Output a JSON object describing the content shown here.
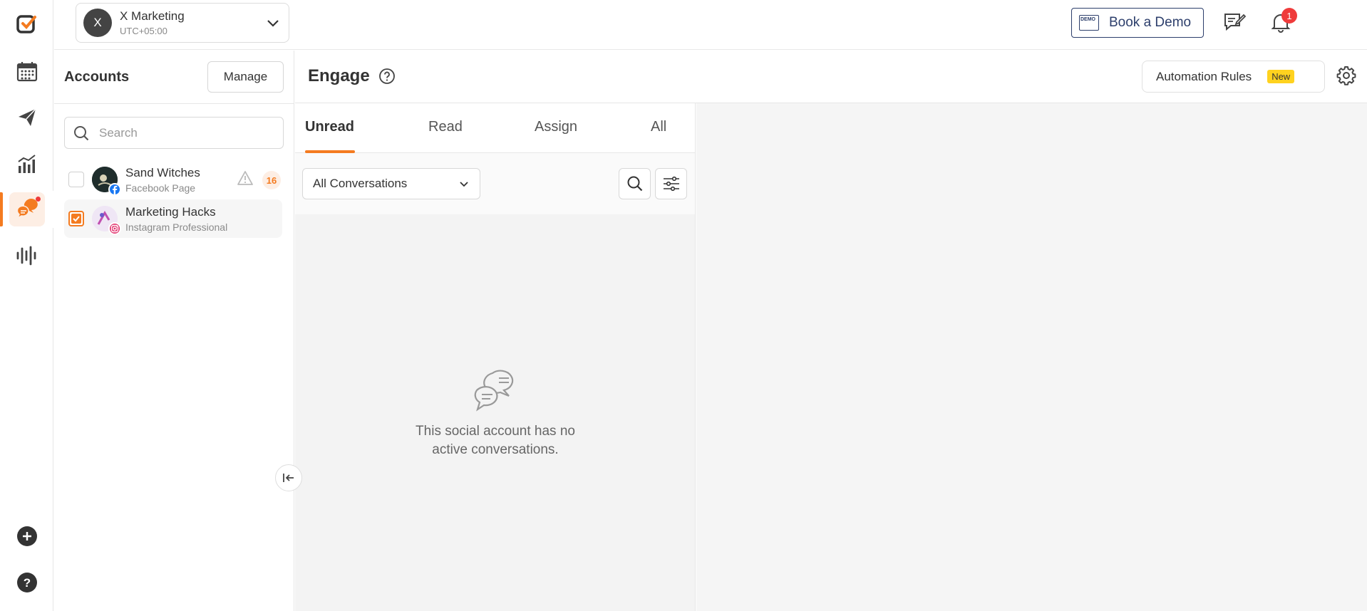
{
  "rail": {
    "items": [
      {
        "icon": "logo-icon"
      },
      {
        "icon": "calendar-icon"
      },
      {
        "icon": "send-icon"
      },
      {
        "icon": "analytics-icon"
      },
      {
        "icon": "engage-chat-icon",
        "active": true
      },
      {
        "icon": "listening-waves-icon"
      }
    ],
    "bottom": [
      {
        "icon": "add-icon"
      },
      {
        "icon": "help-icon"
      }
    ]
  },
  "workspace": {
    "initial": "X",
    "name": "X Marketing",
    "timezone": "UTC+05:00"
  },
  "header": {
    "demo_badge": "DEMO",
    "book_demo": "Book a Demo",
    "notification_count": "1"
  },
  "accounts": {
    "title": "Accounts",
    "manage_label": "Manage",
    "search_placeholder": "Search",
    "items": [
      {
        "name": "Sand Witches",
        "type": "Facebook Page",
        "count": "16",
        "checked": false,
        "warning": true
      },
      {
        "name": "Marketing Hacks",
        "type": "Instagram Professional",
        "checked": true
      }
    ]
  },
  "engage": {
    "title": "Engage",
    "automation_label": "Automation Rules",
    "new_badge": "New",
    "tabs": [
      "Unread",
      "Read",
      "Assign",
      "All"
    ],
    "active_tab": "Unread",
    "filter": "All Conversations",
    "empty_line1": "This social account has no",
    "empty_line2": "active conversations."
  },
  "colors": {
    "accent": "#f47b20",
    "facebook": "#1877f2",
    "instagram": "#e1306c",
    "alert": "#ef3b3b",
    "new_badge": "#ffd21f"
  }
}
